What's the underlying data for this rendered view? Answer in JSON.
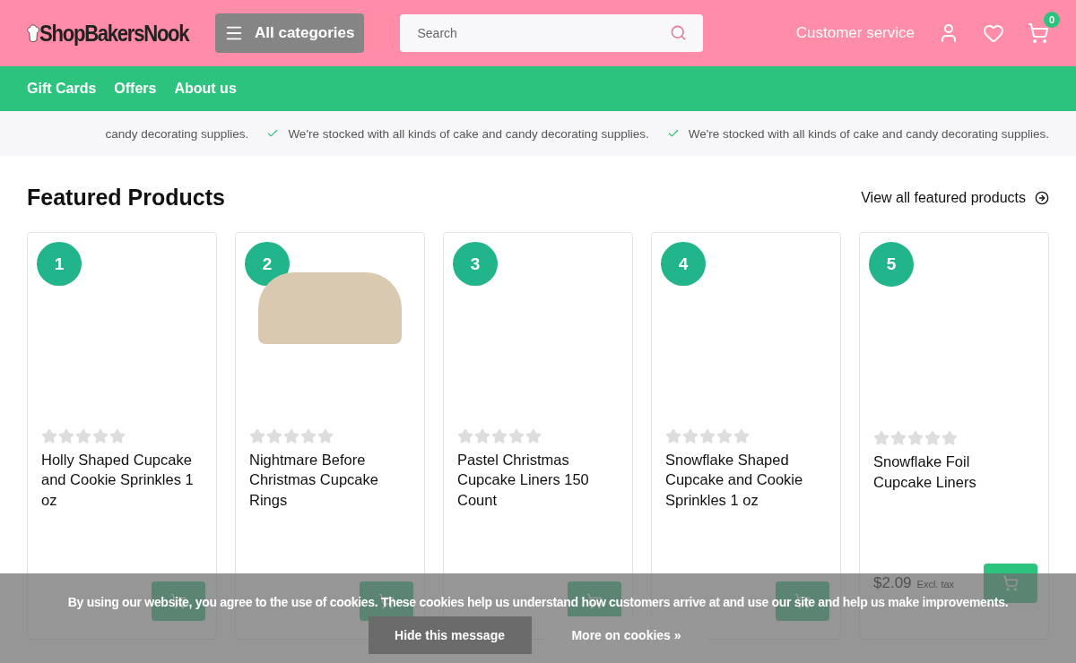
{
  "header": {
    "logo": "ShopBakersNook",
    "categories_button": "All categories",
    "search": {
      "placeholder": "Search"
    },
    "customer_service": "Customer service",
    "cart_count": "0"
  },
  "nav": [
    "Gift Cards",
    "Offers",
    "About us"
  ],
  "usp_bar": [
    {
      "kind": "cut",
      "text": "candy decorating supplies."
    },
    {
      "kind": "check",
      "text": "We're stocked with all kinds of cake and candy decorating supplies."
    },
    {
      "kind": "check",
      "text": "We're stocked with all kinds of cake and candy decorating supplies."
    }
  ],
  "featured": {
    "title": "Featured Products",
    "view_all": "View all featured products",
    "products": [
      {
        "rank": "1",
        "has_photo": false,
        "stars": 0,
        "name": "Holly Shaped Cupcake and Cookie Sprinkles 1 oz"
      },
      {
        "rank": "2",
        "has_photo": true,
        "stars": 0,
        "name": "Nightmare Before Christmas Cupcake Rings"
      },
      {
        "rank": "3",
        "has_photo": false,
        "stars": 0,
        "name": "Pastel Christmas Cupcake Liners 150 Count"
      },
      {
        "rank": "4",
        "has_photo": false,
        "stars": 0,
        "name": "Snowflake Shaped Cupcake and Cookie Sprinkles 1 oz"
      },
      {
        "rank": "5",
        "has_photo": false,
        "stars": 0,
        "name": "Snowflake Foil Cupcake Liners",
        "price": "$2.09",
        "tax_note": "Excl. tax"
      }
    ]
  },
  "cookie_notice": {
    "text": "By using our website, you agree to the use of cookies. These cookies help us understand how customers arrive at and use our site and help us make improvements.",
    "buttons": [
      {
        "kind": "dark",
        "label": "Hide this message"
      },
      {
        "kind": "light",
        "label": "More on cookies »"
      }
    ]
  }
}
